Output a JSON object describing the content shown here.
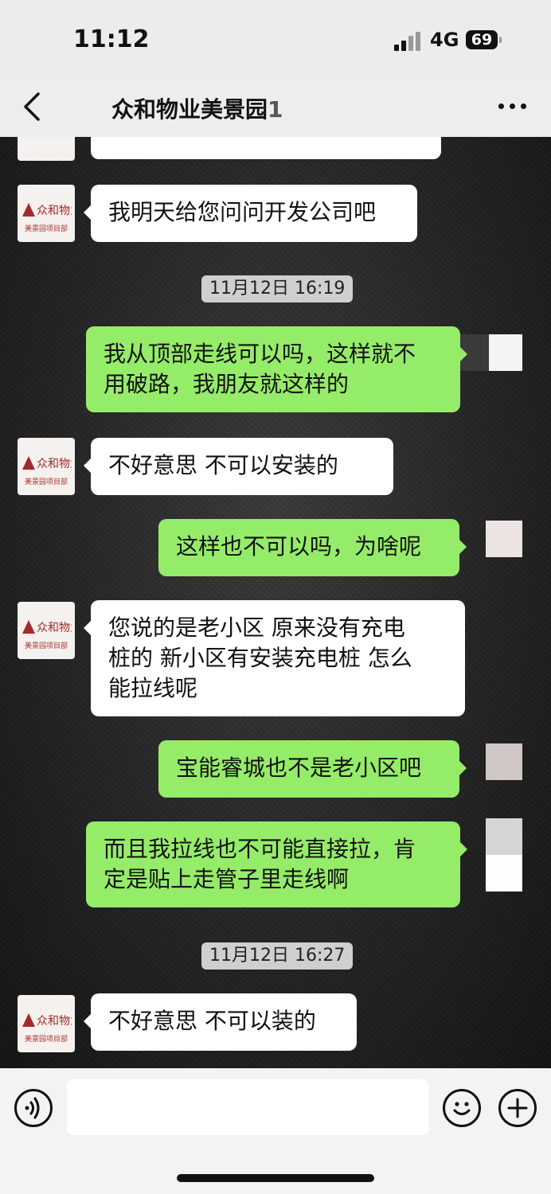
{
  "status_bar": {
    "time": "11:12",
    "network": "4G",
    "battery": "69"
  },
  "header": {
    "title": "众和物业美景园",
    "title_suffix": "1"
  },
  "avatar": {
    "logo_text": "众和物业",
    "sub_text": "美景园项目部"
  },
  "messages": [
    {
      "side": "in",
      "text": "我明天给您问问开发公司吧"
    },
    {
      "type": "timestamp",
      "text": "11月12日 16:19"
    },
    {
      "side": "out",
      "lines": [
        "我从顶部走线可以吗，这样就不",
        "用破路，我朋友就这样的"
      ]
    },
    {
      "side": "in",
      "text": "不好意思 不可以安装的"
    },
    {
      "side": "out",
      "text": "这样也不可以吗，为啥呢"
    },
    {
      "side": "in",
      "lines": [
        "您说的是老小区  原来没有充电",
        "桩的  新小区有安装充电桩  怎么",
        "能拉线呢"
      ]
    },
    {
      "side": "out",
      "text": "宝能睿城也不是老小区吧"
    },
    {
      "side": "out",
      "lines": [
        "而且我拉线也不可能直接拉，肯",
        "定是贴上走管子里走线啊"
      ]
    },
    {
      "type": "timestamp",
      "text": "11月12日 16:27"
    },
    {
      "side": "in",
      "text": "不好意思  不可以装的"
    }
  ],
  "colors": {
    "outgoing_bubble": "#95ec69",
    "incoming_bubble": "#ffffff",
    "brand_red": "#a32a2a"
  },
  "icons": {
    "back": "chevron-left-icon",
    "more": "more-dots-icon",
    "voice": "voice-icon",
    "emoji": "emoji-icon",
    "plus": "plus-icon"
  }
}
